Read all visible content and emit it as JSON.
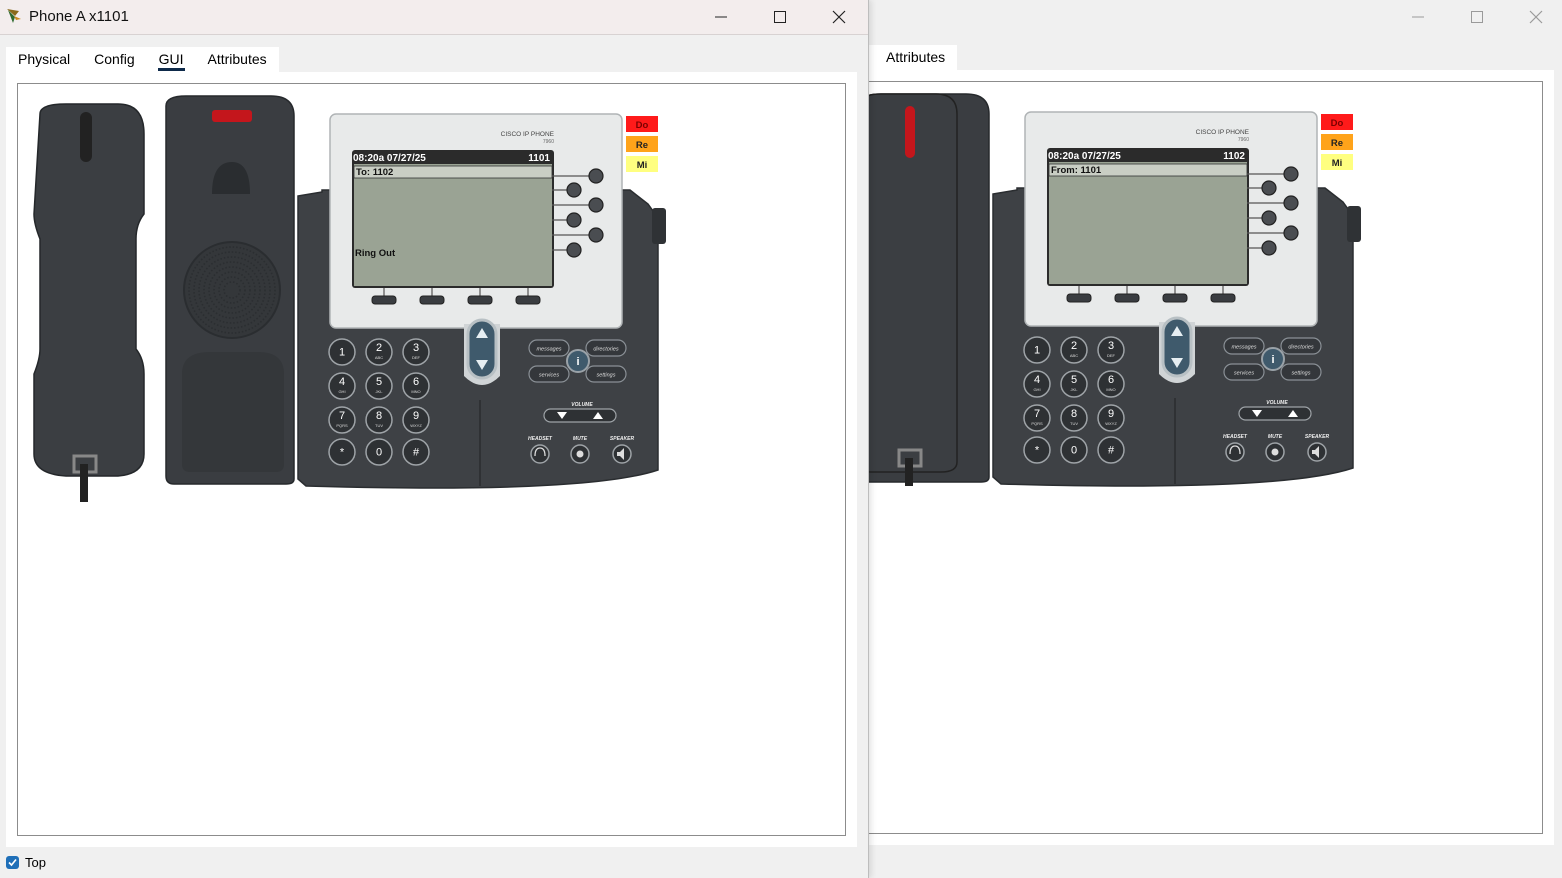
{
  "windowA": {
    "title": "Phone A x1101",
    "tabs": [
      "Physical",
      "Config",
      "GUI",
      "Attributes"
    ],
    "active_tab": "GUI",
    "phone": {
      "brand": "CISCO IP PHONE",
      "model": "7960",
      "time_date": "08:20a 07/27/25",
      "extension": "1101",
      "line1": "To: 1102",
      "status": "Ring Out",
      "dnd_label": "Do",
      "redial_label": "Re",
      "missed_label": "Mi"
    },
    "top_checkbox_label": "Top",
    "top_checked": true
  },
  "windowB": {
    "tabs": [
      "Attributes"
    ],
    "phone": {
      "brand": "CISCO IP PHONE",
      "model": "7960",
      "time_date": "08:20a 07/27/25",
      "extension": "1102",
      "line1": "From: 1101",
      "dnd_label": "Do",
      "redial_label": "Re",
      "missed_label": "Mi"
    }
  },
  "phone_labels": {
    "keys": [
      {
        "num": "1",
        "letters": ""
      },
      {
        "num": "2",
        "letters": "ABC"
      },
      {
        "num": "3",
        "letters": "DEF"
      },
      {
        "num": "4",
        "letters": "GHI"
      },
      {
        "num": "5",
        "letters": "JKL"
      },
      {
        "num": "6",
        "letters": "MNO"
      },
      {
        "num": "7",
        "letters": "PQRS"
      },
      {
        "num": "8",
        "letters": "TUV"
      },
      {
        "num": "9",
        "letters": "WXYZ"
      },
      {
        "num": "*",
        "letters": ""
      },
      {
        "num": "0",
        "letters": ""
      },
      {
        "num": "#",
        "letters": ""
      }
    ],
    "messages": "messages",
    "directories": "directories",
    "services": "services",
    "settings": "settings",
    "info": "i",
    "volume": "VOLUME",
    "headset": "HEADSET",
    "mute": "MUTE",
    "speaker": "SPEAKER"
  },
  "colors": {
    "dnd": "#ff1a1a",
    "redial": "#ffa31a",
    "missed": "#ffff80",
    "screen": "#9aa394",
    "screen_header": "#2a2a2a",
    "phone_body": "#3d4044",
    "tab_underline": "#0e2a4a"
  }
}
